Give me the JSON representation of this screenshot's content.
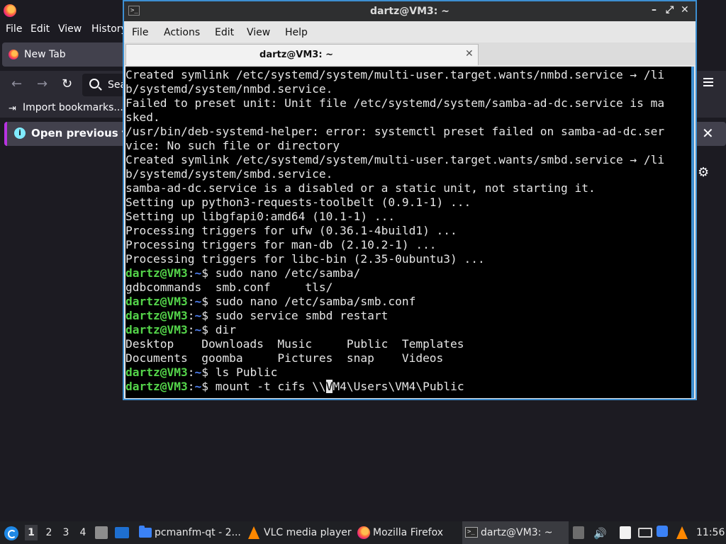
{
  "firefox": {
    "menu": [
      "File",
      "Edit",
      "View",
      "History"
    ],
    "tab_label": "New Tab",
    "search_placeholder": "Sea",
    "bookmarks_import": "Import bookmarks...",
    "infobar_text": "Open previous ta",
    "colors": {
      "bg": "#1c1b22",
      "toolbar": "#2b2a33",
      "accent": "#b833e1"
    }
  },
  "terminal": {
    "window_title": "dartz@VM3: ~",
    "menu": [
      "File",
      "Actions",
      "Edit",
      "View",
      "Help"
    ],
    "tab_title": "dartz@VM3: ~",
    "lines": [
      {
        "type": "out",
        "text": "Created symlink /etc/systemd/system/multi-user.target.wants/nmbd.service → /li"
      },
      {
        "type": "out",
        "text": "b/systemd/system/nmbd.service."
      },
      {
        "type": "out",
        "text": "Failed to preset unit: Unit file /etc/systemd/system/samba-ad-dc.service is ma"
      },
      {
        "type": "out",
        "text": "sked."
      },
      {
        "type": "out",
        "text": "/usr/bin/deb-systemd-helper: error: systemctl preset failed on samba-ad-dc.ser"
      },
      {
        "type": "out",
        "text": "vice: No such file or directory"
      },
      {
        "type": "out",
        "text": "Created symlink /etc/systemd/system/multi-user.target.wants/smbd.service → /li"
      },
      {
        "type": "out",
        "text": "b/systemd/system/smbd.service."
      },
      {
        "type": "out",
        "text": "samba-ad-dc.service is a disabled or a static unit, not starting it."
      },
      {
        "type": "out",
        "text": "Setting up python3-requests-toolbelt (0.9.1-1) ..."
      },
      {
        "type": "out",
        "text": "Setting up libgfapi0:amd64 (10.1-1) ..."
      },
      {
        "type": "out",
        "text": "Processing triggers for ufw (0.36.1-4build1) ..."
      },
      {
        "type": "out",
        "text": "Processing triggers for man-db (2.10.2-1) ..."
      },
      {
        "type": "out",
        "text": "Processing triggers for libc-bin (2.35-0ubuntu3) ..."
      },
      {
        "type": "cmd",
        "text": "sudo nano /etc/samba/"
      },
      {
        "type": "out",
        "text": "gdbcommands  smb.conf     tls/"
      },
      {
        "type": "cmd",
        "text": "sudo nano /etc/samba/smb.conf"
      },
      {
        "type": "cmd",
        "text": "sudo service smbd restart"
      },
      {
        "type": "cmd",
        "text": "dir"
      },
      {
        "type": "out",
        "text": "Desktop    Downloads  Music     Public  Templates"
      },
      {
        "type": "out",
        "text": "Documents  goomba     Pictures  snap    Videos"
      },
      {
        "type": "cmd",
        "text": "ls Public"
      }
    ],
    "prompt_user": "dartz@VM3",
    "prompt_colon": ":",
    "prompt_path": "~",
    "prompt_dollar": "$ ",
    "current_cmd_before_cursor": "mount -t cifs \\\\",
    "cursor_char": "V",
    "current_cmd_after_cursor": "M4\\Users\\VM4\\Public",
    "colors": {
      "border": "#3d8fd1",
      "user": "#54d44a",
      "path": "#4e7ff0"
    }
  },
  "taskbar": {
    "workspaces": [
      "1",
      "2",
      "3",
      "4"
    ],
    "active_workspace": "1",
    "tasks": [
      {
        "label": "pcmanfm-qt - 2...",
        "icon": "folder-icon"
      },
      {
        "label": "VLC media player",
        "icon": "vlc-icon"
      },
      {
        "label": "Mozilla Firefox",
        "icon": "firefox-icon"
      },
      {
        "label": "dartz@VM3: ~",
        "icon": "terminal-icon"
      }
    ],
    "clock": "11:56"
  }
}
